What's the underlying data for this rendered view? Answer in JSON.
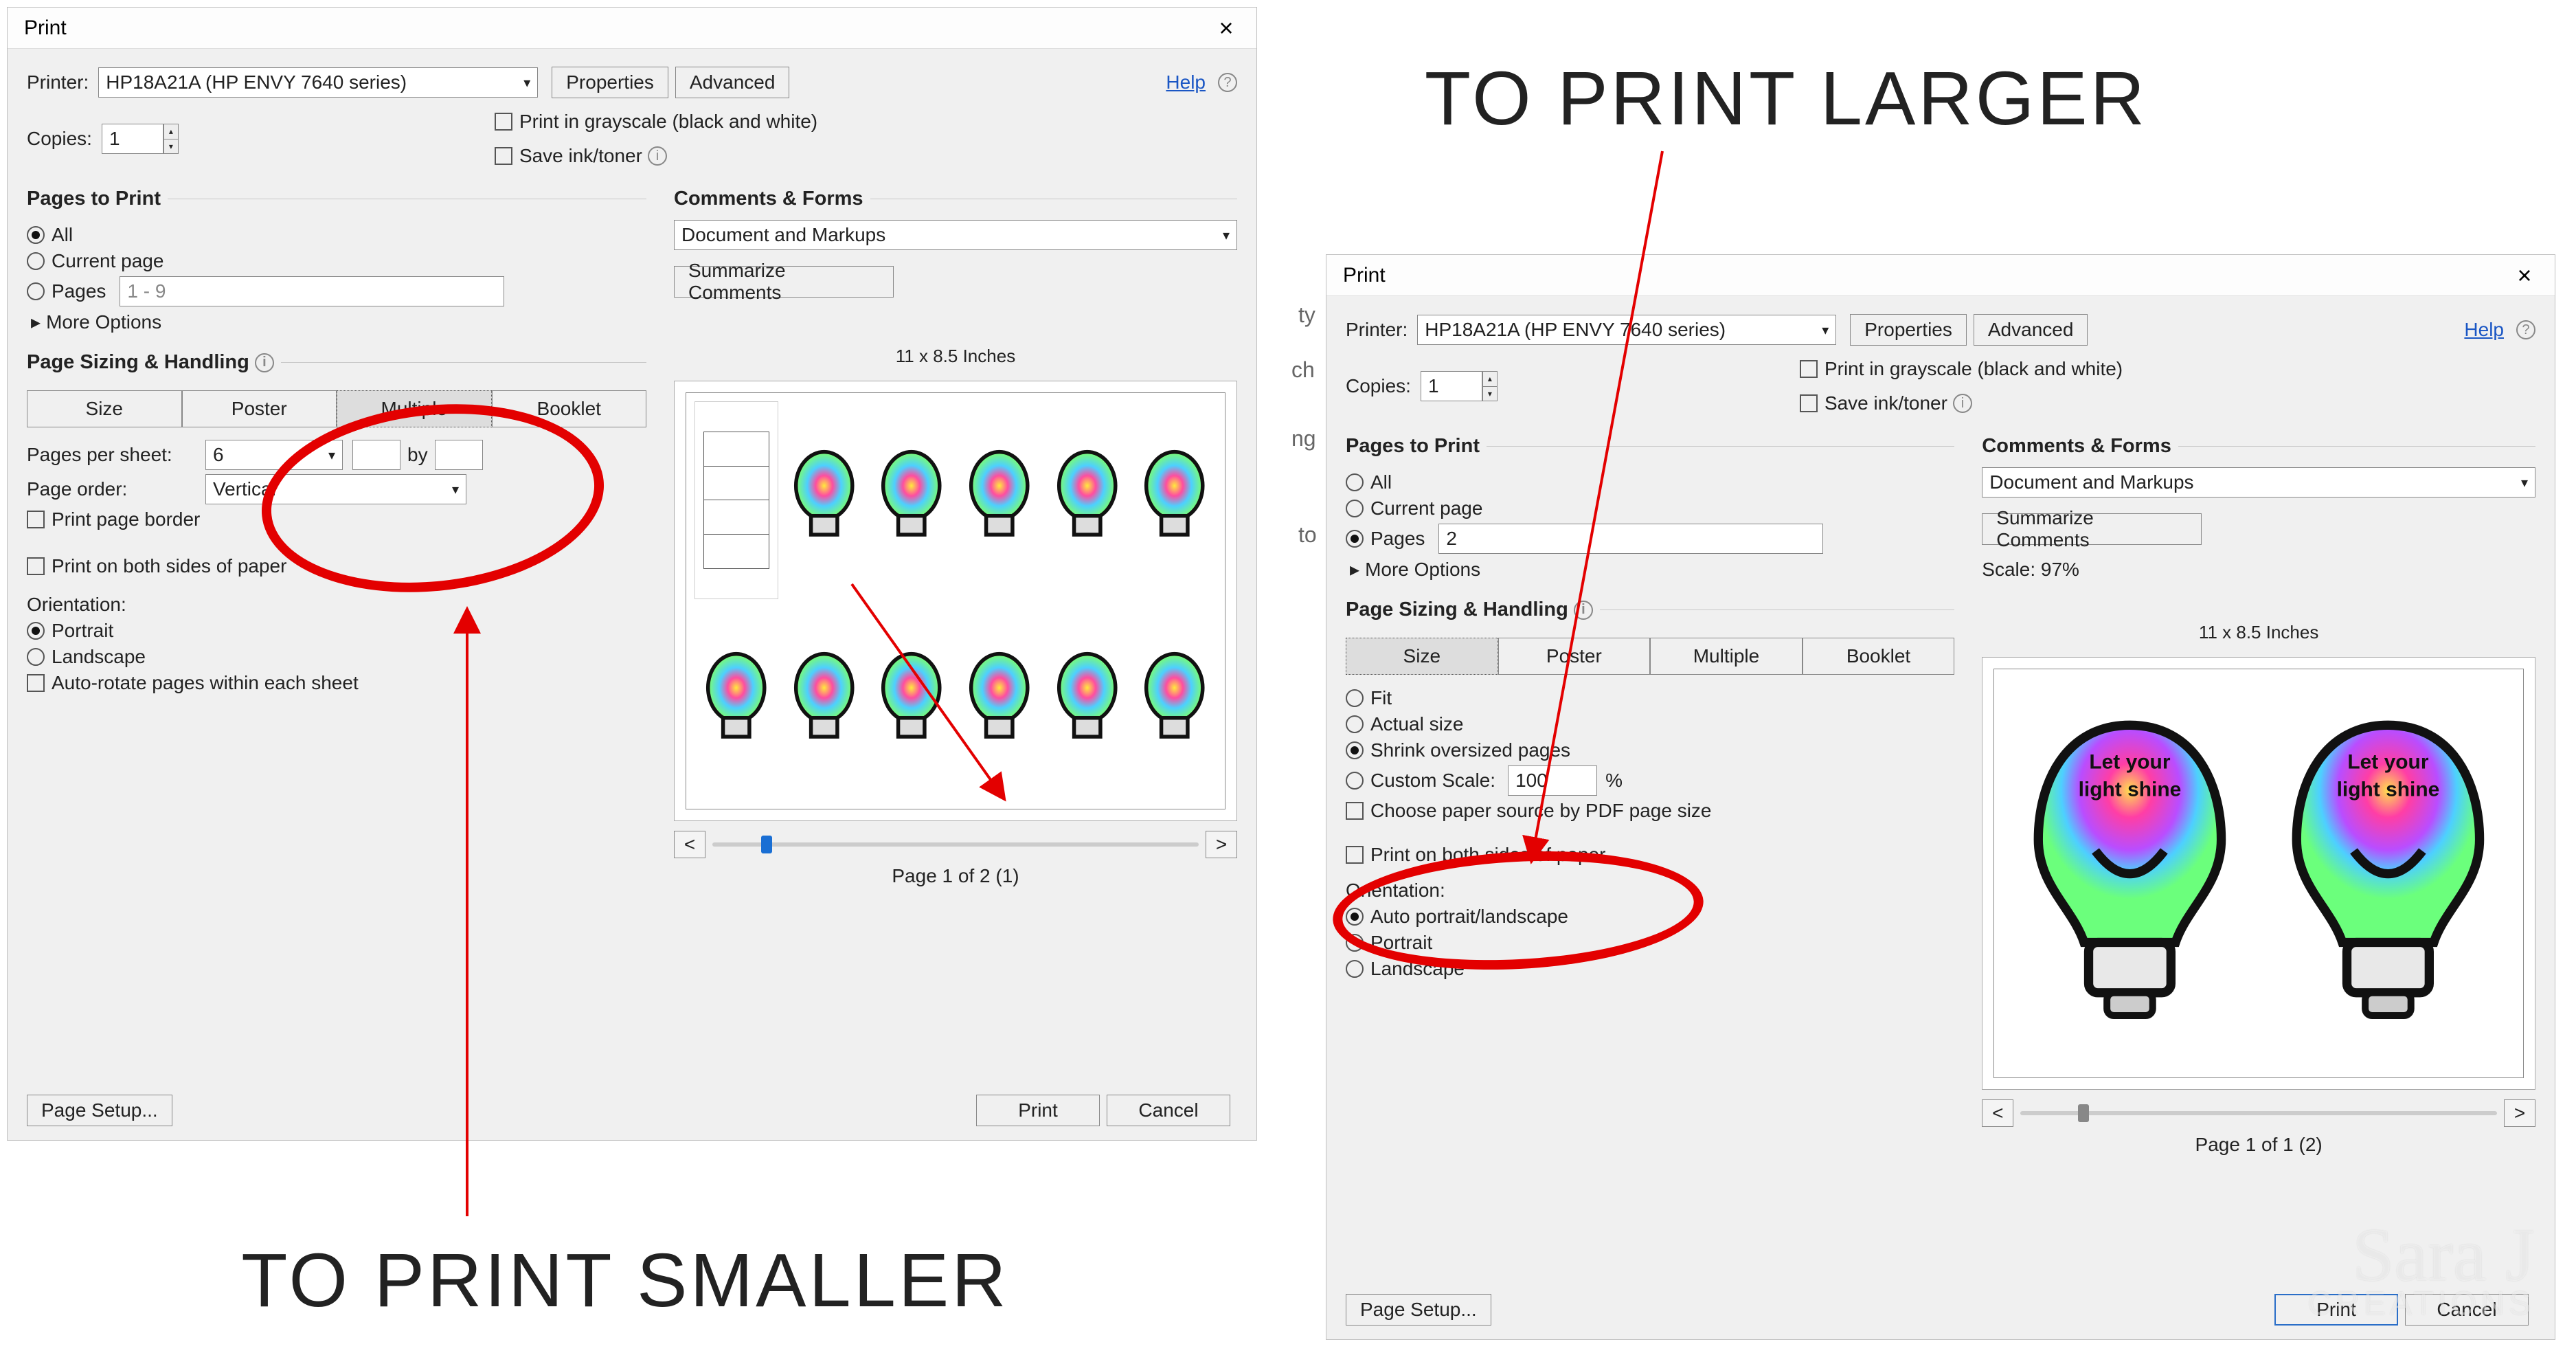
{
  "annotations": {
    "larger": "TO PRINT LARGER",
    "smaller": "TO PRINT SMALLER"
  },
  "bg_text_fragments": [
    "ty",
    "ch",
    "ng",
    "to"
  ],
  "watermark": {
    "line1": "Sara J",
    "line2": "CREATIONS"
  },
  "dialog_left": {
    "title": "Print",
    "printer_label": "Printer:",
    "printer_value": "HP18A21A (HP ENVY 7640 series)",
    "properties_btn": "Properties",
    "advanced_btn": "Advanced",
    "help_link": "Help",
    "copies_label": "Copies:",
    "copies_value": "1",
    "grayscale_label": "Print in grayscale (black and white)",
    "save_ink_label": "Save ink/toner",
    "pages_to_print": {
      "legend": "Pages to Print",
      "all": "All",
      "current": "Current page",
      "pages": "Pages",
      "pages_value": "1 - 9",
      "more_options": "More Options"
    },
    "comments_forms": {
      "legend": "Comments & Forms",
      "select_value": "Document and Markups",
      "summarize_btn": "Summarize Comments"
    },
    "sizing": {
      "legend": "Page Sizing & Handling",
      "size": "Size",
      "poster": "Poster",
      "multiple": "Multiple",
      "booklet": "Booklet",
      "pages_per_sheet_label": "Pages per sheet:",
      "pages_per_sheet_value": "6",
      "by": "by",
      "page_order_label": "Page order:",
      "page_order_value": "Vertical",
      "print_page_border": "Print page border",
      "print_both_sides": "Print on both sides of paper",
      "orientation_label": "Orientation:",
      "portrait": "Portrait",
      "landscape": "Landscape",
      "auto_rotate": "Auto-rotate pages within each sheet"
    },
    "preview": {
      "dimensions": "11 x 8.5 Inches",
      "page_info": "Page 1 of 2 (1)"
    },
    "footer": {
      "page_setup": "Page Setup...",
      "print": "Print",
      "cancel": "Cancel"
    }
  },
  "dialog_right": {
    "title": "Print",
    "printer_label": "Printer:",
    "printer_value": "HP18A21A (HP ENVY 7640 series)",
    "properties_btn": "Properties",
    "advanced_btn": "Advanced",
    "help_link": "Help",
    "copies_label": "Copies:",
    "copies_value": "1",
    "grayscale_label": "Print in grayscale (black and white)",
    "save_ink_label": "Save ink/toner",
    "pages_to_print": {
      "legend": "Pages to Print",
      "all": "All",
      "current": "Current page",
      "pages": "Pages",
      "pages_value": "2",
      "more_options": "More Options"
    },
    "comments_forms": {
      "legend": "Comments & Forms",
      "select_value": "Document and Markups",
      "summarize_btn": "Summarize Comments",
      "scale_label": "Scale:  97%"
    },
    "sizing": {
      "legend": "Page Sizing & Handling",
      "size": "Size",
      "poster": "Poster",
      "multiple": "Multiple",
      "booklet": "Booklet",
      "fit": "Fit",
      "actual": "Actual size",
      "shrink": "Shrink oversized pages",
      "custom_scale": "Custom Scale:",
      "custom_scale_value": "100",
      "percent": "%",
      "choose_source": "Choose paper source by PDF page size",
      "print_both_sides": "Print on both sides of paper",
      "orientation_label": "Orientation:",
      "auto_orient": "Auto portrait/landscape",
      "portrait": "Portrait",
      "landscape": "Landscape"
    },
    "preview": {
      "dimensions": "11 x 8.5 Inches",
      "bulb_text1": "Let your",
      "bulb_text2": "light shine",
      "page_info": "Page 1 of 1 (2)"
    },
    "footer": {
      "page_setup": "Page Setup...",
      "print": "Print",
      "cancel": "Cancel"
    }
  }
}
